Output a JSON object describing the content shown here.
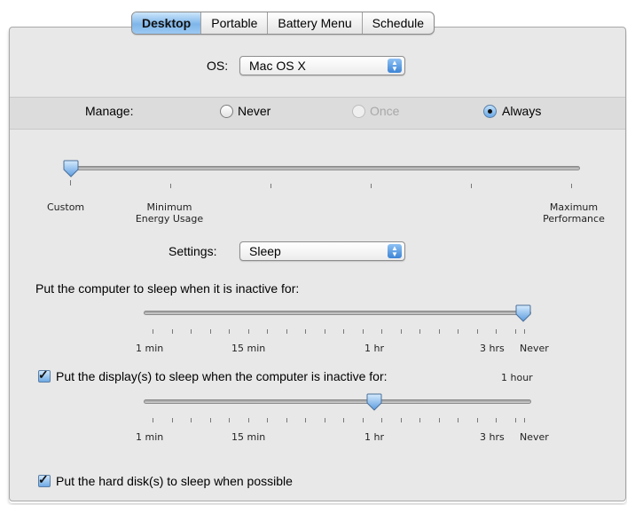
{
  "tabs": [
    "Desktop",
    "Portable",
    "Battery Menu",
    "Schedule"
  ],
  "active_tab": "Desktop",
  "os": {
    "label": "OS:",
    "value": "Mac OS X"
  },
  "manage": {
    "label": "Manage:",
    "options": [
      {
        "label": "Never",
        "state": "unselected"
      },
      {
        "label": "Once",
        "state": "disabled"
      },
      {
        "label": "Always",
        "state": "selected"
      }
    ]
  },
  "energy_slider": {
    "value_index": 0,
    "labels": {
      "custom": "Custom",
      "minimum": [
        "Minimum",
        "Energy Usage"
      ],
      "maximum": [
        "Maximum",
        "Performance"
      ]
    }
  },
  "settings": {
    "label": "Settings:",
    "value": "Sleep"
  },
  "computer_sleep": {
    "label": "Put the computer to sleep when it is inactive for:",
    "value": "Never",
    "ticks": [
      "1 min",
      "15 min",
      "1 hr",
      "3 hrs",
      "Never"
    ]
  },
  "display_sleep": {
    "label": "Put the display(s) to sleep when the computer is inactive for:",
    "checked": true,
    "value_text": "1 hour",
    "ticks": [
      "1 min",
      "15 min",
      "1 hr",
      "3 hrs",
      "Never"
    ]
  },
  "disk_sleep": {
    "label": "Put the hard disk(s) to sleep when possible",
    "checked": true
  },
  "colors": {
    "accent": "#6aa8e6",
    "panel": "#e8e8e8"
  }
}
